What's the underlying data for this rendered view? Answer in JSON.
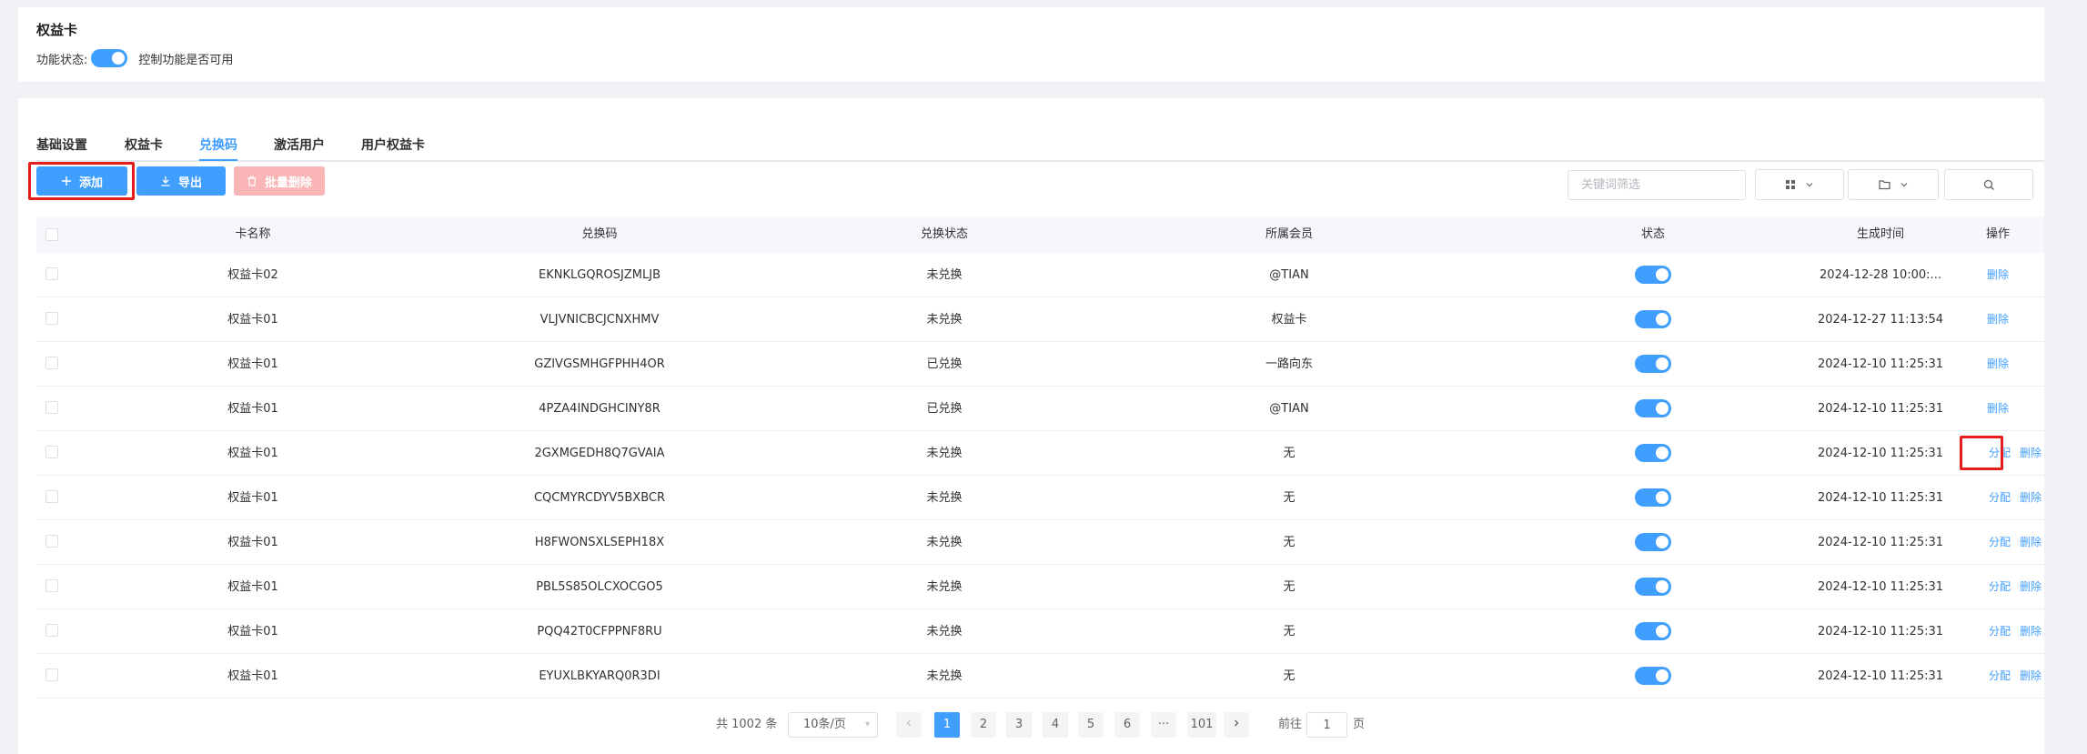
{
  "header": {
    "title": "权益卡",
    "status_label": "功能状态:",
    "status_hint": "控制功能是否可用"
  },
  "tabs": [
    {
      "label": "基础设置"
    },
    {
      "label": "权益卡"
    },
    {
      "label": "兑换码",
      "active": true
    },
    {
      "label": "激活用户"
    },
    {
      "label": "用户权益卡"
    }
  ],
  "toolbar": {
    "add_label": "添加",
    "export_label": "导出",
    "batch_delete_label": "批量删除",
    "search_placeholder": "关键词筛选"
  },
  "table": {
    "columns": [
      "卡名称",
      "兑换码",
      "兑换状态",
      "所属会员",
      "状态",
      "生成时间",
      "操作"
    ],
    "rows": [
      {
        "card": "权益卡02",
        "code": "EKNKLGQROSJZMLJB",
        "redeem": "未兑换",
        "member": "@TIAN",
        "enabled": true,
        "time": "2024-12-28 10:00:...",
        "actions": [
          "删除"
        ]
      },
      {
        "card": "权益卡01",
        "code": "VLJVNICBCJCNXHMV",
        "redeem": "未兑换",
        "member": "权益卡",
        "enabled": true,
        "time": "2024-12-27 11:13:54",
        "actions": [
          "删除"
        ]
      },
      {
        "card": "权益卡01",
        "code": "GZIVGSMHGFPHH4OR",
        "redeem": "已兑换",
        "member": "一路向东",
        "enabled": true,
        "time": "2024-12-10 11:25:31",
        "actions": [
          "删除"
        ]
      },
      {
        "card": "权益卡01",
        "code": "4PZA4INDGHCINY8R",
        "redeem": "已兑换",
        "member": "@TIAN",
        "enabled": true,
        "time": "2024-12-10 11:25:31",
        "actions": [
          "删除"
        ]
      },
      {
        "card": "权益卡01",
        "code": "2GXMGEDH8Q7GVAIA",
        "redeem": "未兑换",
        "member": "无",
        "enabled": true,
        "time": "2024-12-10 11:25:31",
        "actions": [
          "分配",
          "删除"
        ]
      },
      {
        "card": "权益卡01",
        "code": "CQCMYRCDYV5BXBCR",
        "redeem": "未兑换",
        "member": "无",
        "enabled": true,
        "time": "2024-12-10 11:25:31",
        "actions": [
          "分配",
          "删除"
        ]
      },
      {
        "card": "权益卡01",
        "code": "H8FWONSXLSEPH18X",
        "redeem": "未兑换",
        "member": "无",
        "enabled": true,
        "time": "2024-12-10 11:25:31",
        "actions": [
          "分配",
          "删除"
        ]
      },
      {
        "card": "权益卡01",
        "code": "PBL5S85OLCXOCGO5",
        "redeem": "未兑换",
        "member": "无",
        "enabled": true,
        "time": "2024-12-10 11:25:31",
        "actions": [
          "分配",
          "删除"
        ]
      },
      {
        "card": "权益卡01",
        "code": "PQQ42T0CFPPNF8RU",
        "redeem": "未兑换",
        "member": "无",
        "enabled": true,
        "time": "2024-12-10 11:25:31",
        "actions": [
          "分配",
          "删除"
        ]
      },
      {
        "card": "权益卡01",
        "code": "EYUXLBKYARQ0R3DI",
        "redeem": "未兑换",
        "member": "无",
        "enabled": true,
        "time": "2024-12-10 11:25:31",
        "actions": [
          "分配",
          "删除"
        ]
      }
    ]
  },
  "pagination": {
    "total_text": "共 1002 条",
    "page_size": "10条/页",
    "pages": [
      "1",
      "2",
      "3",
      "4",
      "5",
      "6",
      "···",
      "101"
    ],
    "current": "1",
    "goto_label": "前往",
    "goto_value": "1",
    "page_suffix": "页"
  },
  "colors": {
    "primary": "#409eff",
    "danger_light": "#fab6b6",
    "highlight": "#e51d1d"
  },
  "icons": {
    "add": "plus-icon",
    "export": "download-icon",
    "batch_delete": "trash-icon",
    "column_settings": "grid-icon",
    "folder": "folder-icon",
    "search": "search-icon"
  }
}
